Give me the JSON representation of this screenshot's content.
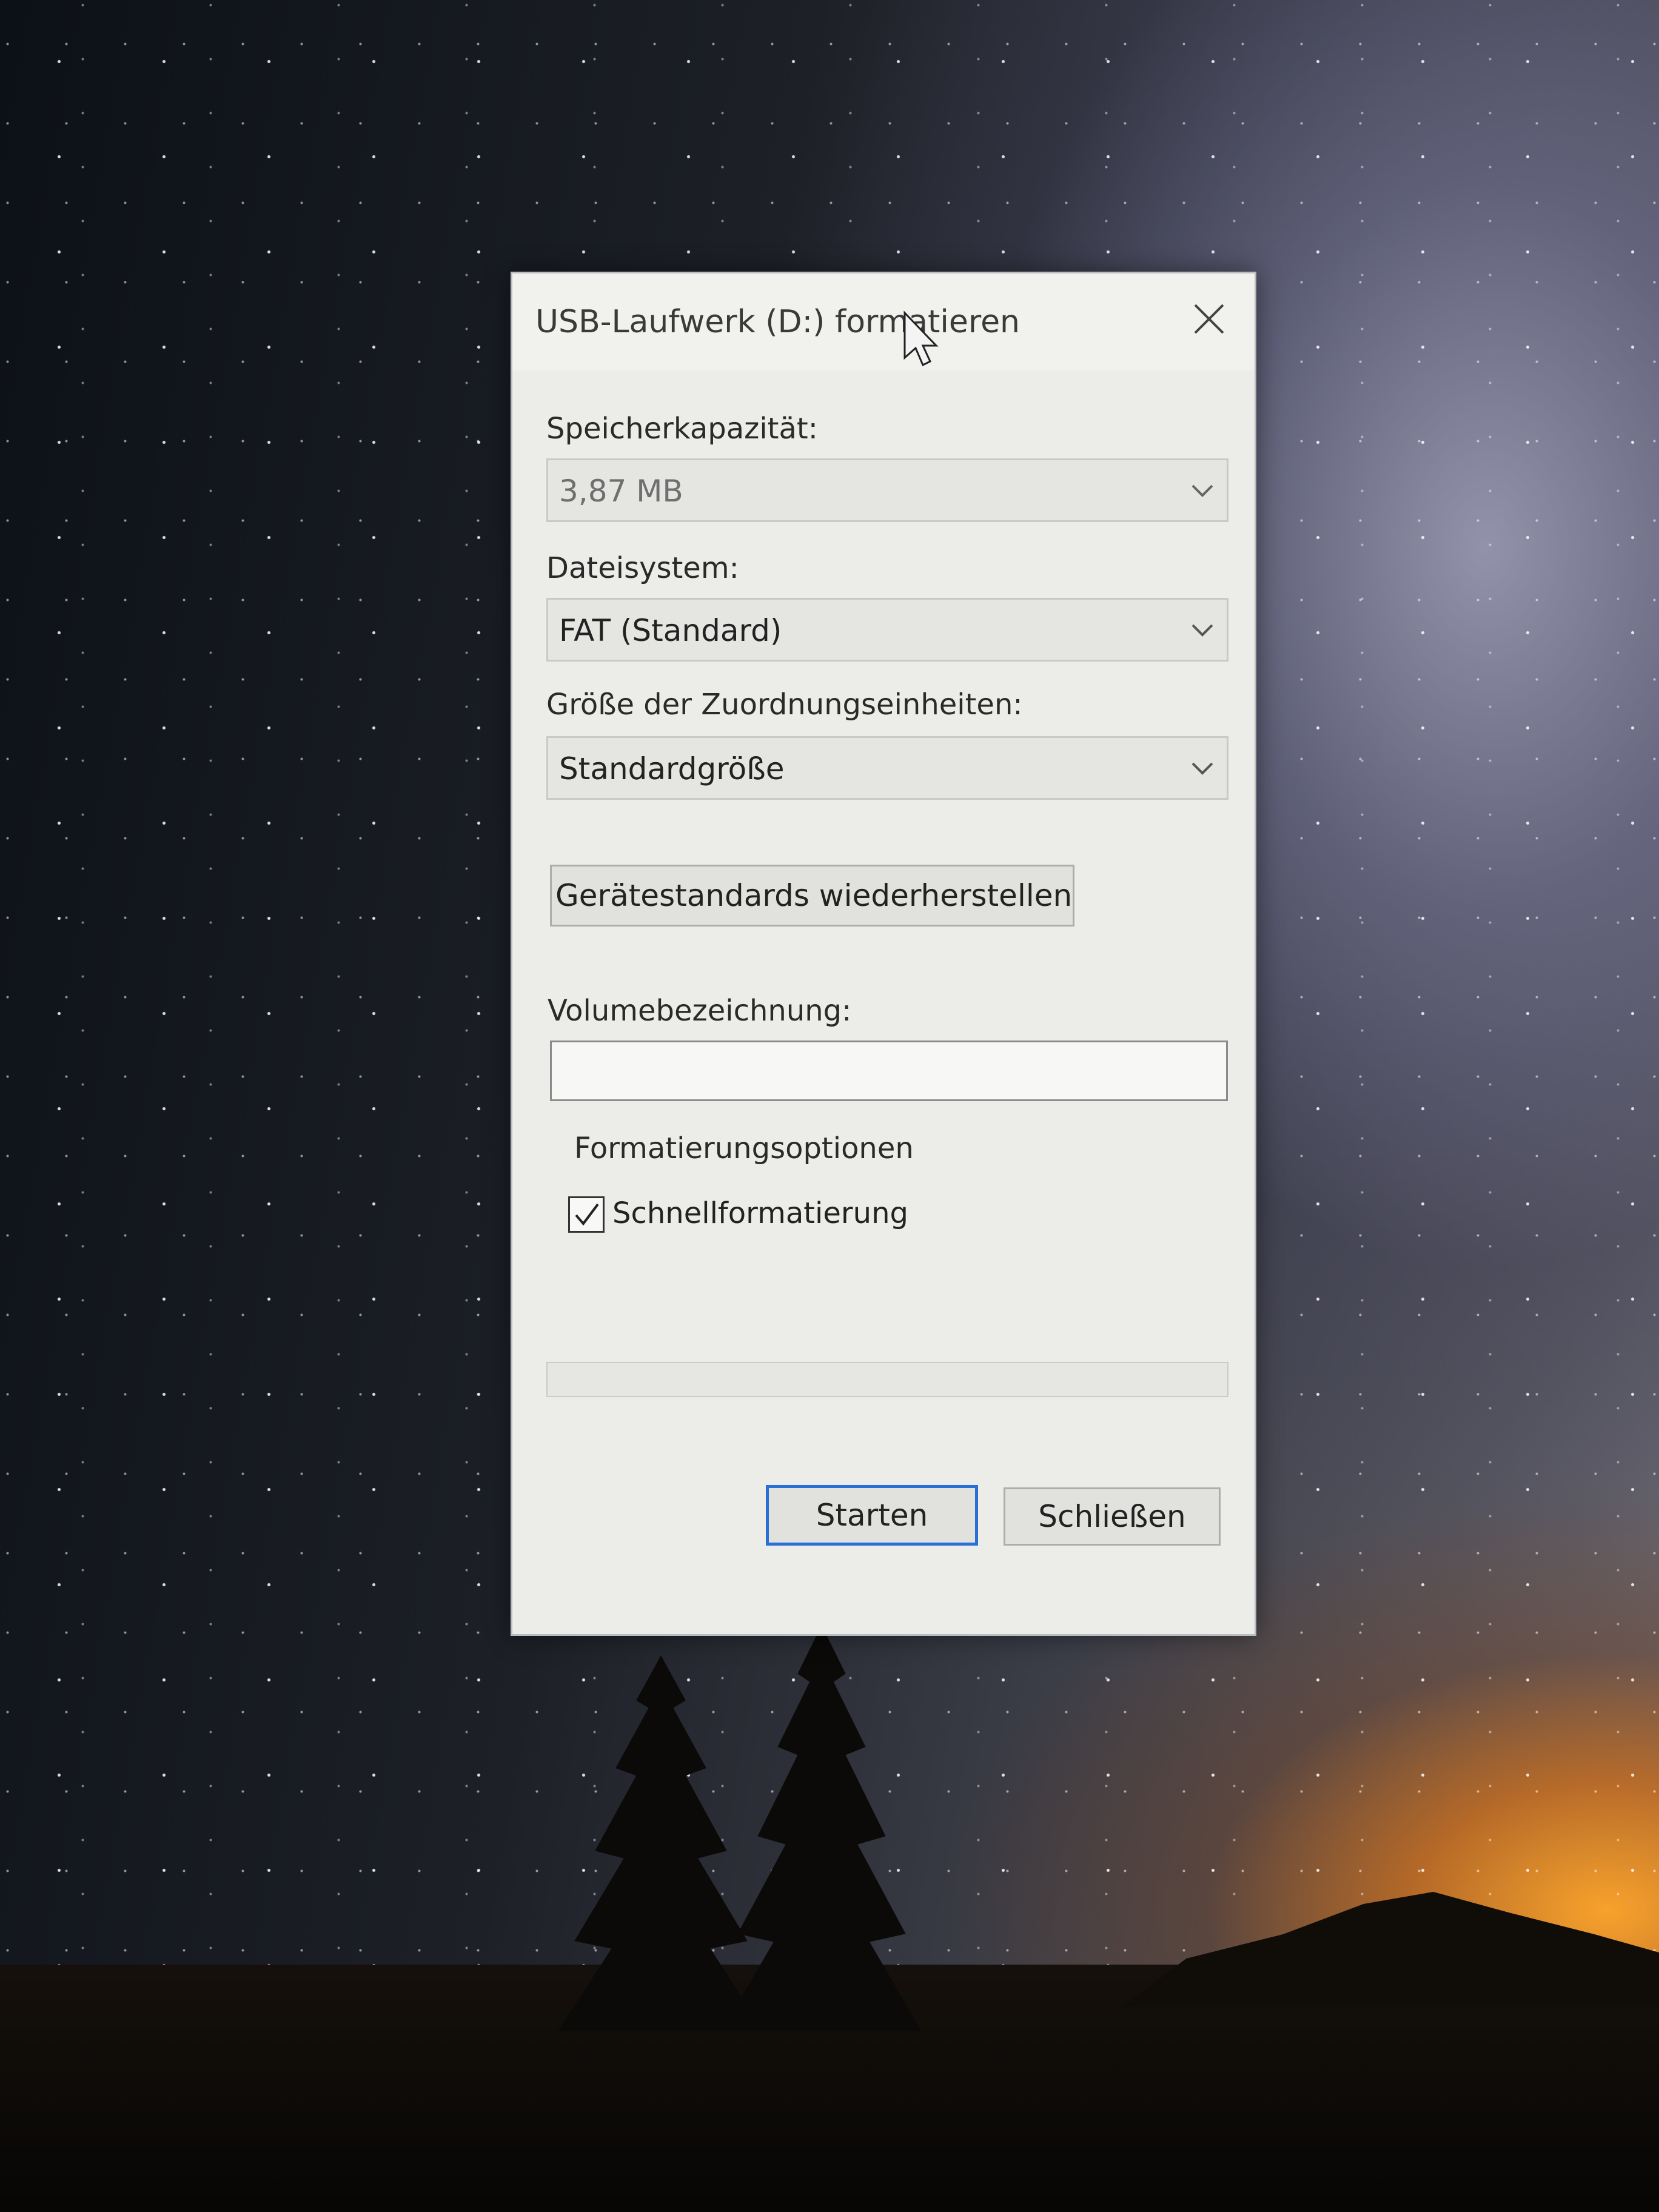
{
  "dialog": {
    "title": "USB-Laufwerk (D:) formatieren",
    "close_icon": "close-icon",
    "capacity": {
      "label": "Speicherkapazität:",
      "value": "3,87 MB"
    },
    "filesystem": {
      "label": "Dateisystem:",
      "value": "FAT (Standard)"
    },
    "allocation": {
      "label": "Größe der Zuordnungseinheiten:",
      "value": "Standardgröße"
    },
    "restore_defaults_label": "Gerätestandards wiederherstellen",
    "volume": {
      "label": "Volumebezeichnung:",
      "value": ""
    },
    "format_options": {
      "title": "Formatierungsoptionen",
      "quick_format_label": "Schnellformatierung",
      "quick_format_checked": true
    },
    "progress_value": 0,
    "start_label": "Starten",
    "close_label": "Schließen"
  },
  "colors": {
    "dialog_bg": "#ecece8",
    "primary_button_border": "#2a6fd6"
  }
}
